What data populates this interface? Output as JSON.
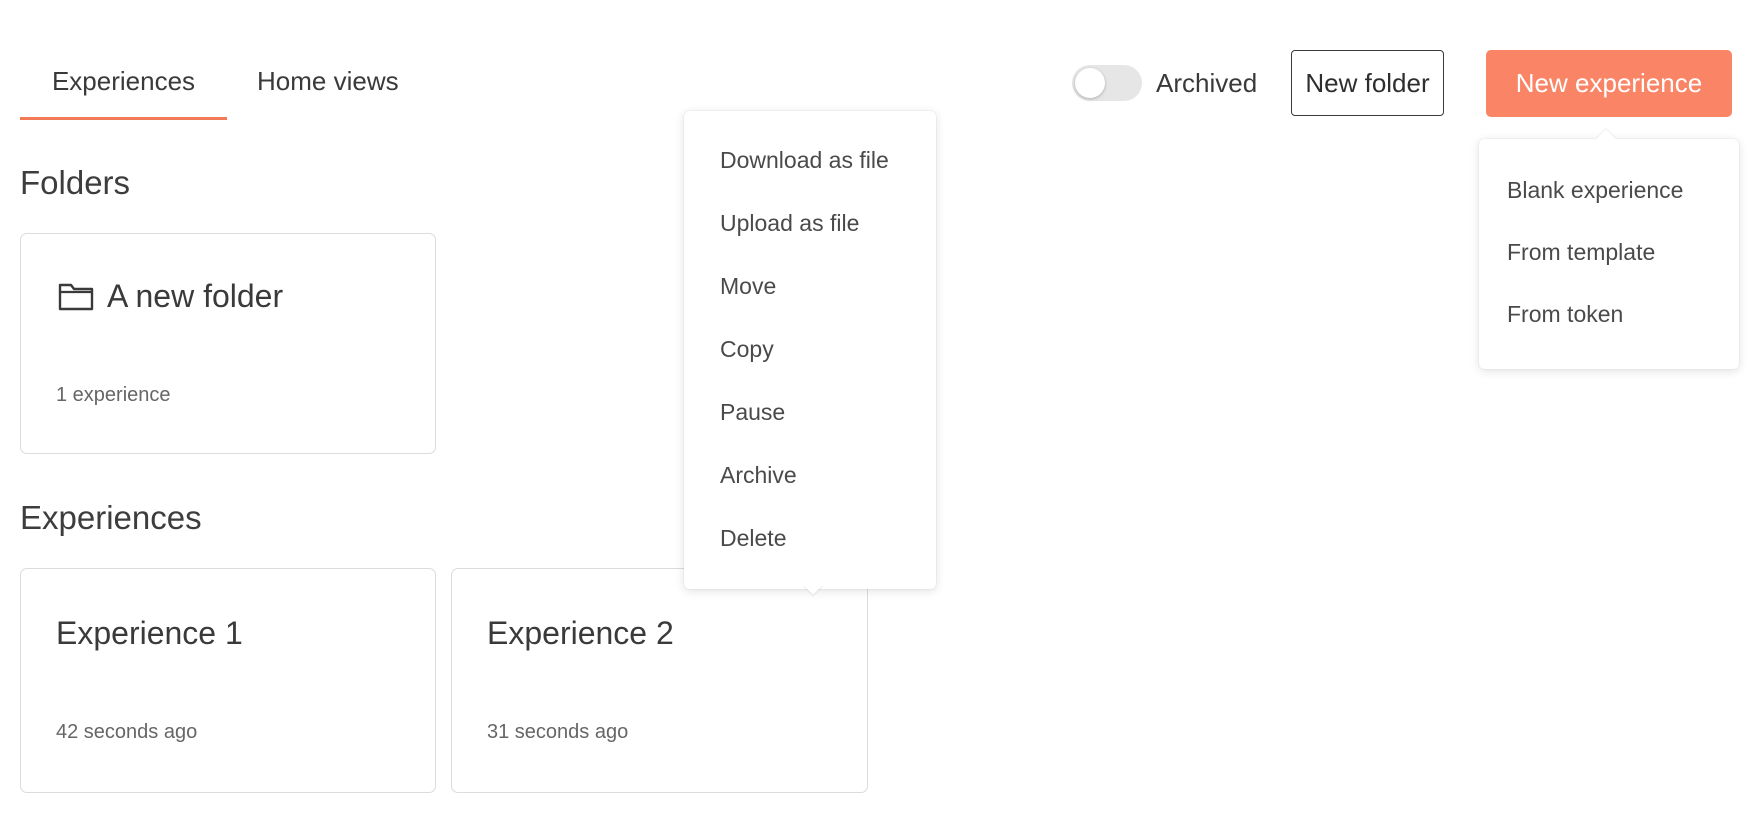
{
  "tabs": [
    {
      "label": "Experiences",
      "active": true
    },
    {
      "label": "Home views",
      "active": false
    }
  ],
  "header": {
    "archived_label": "Archived",
    "archived_on": false,
    "new_folder_label": "New folder",
    "new_experience_label": "New experience",
    "accent_color": "#f98566"
  },
  "new_experience_menu": {
    "items": [
      "Blank experience",
      "From template",
      "From token"
    ]
  },
  "context_menu": {
    "items": [
      "Download as file",
      "Upload as file",
      "Move",
      "Copy",
      "Pause",
      "Archive",
      "Delete"
    ]
  },
  "folders": {
    "title": "Folders",
    "items": [
      {
        "name": "A new folder",
        "count": "1 experience",
        "icon": "folder-icon"
      }
    ]
  },
  "experiences": {
    "title": "Experiences",
    "items": [
      {
        "name": "Experience 1",
        "time": "42 seconds ago"
      },
      {
        "name": "Experience 2",
        "time": "31 seconds ago"
      }
    ]
  }
}
